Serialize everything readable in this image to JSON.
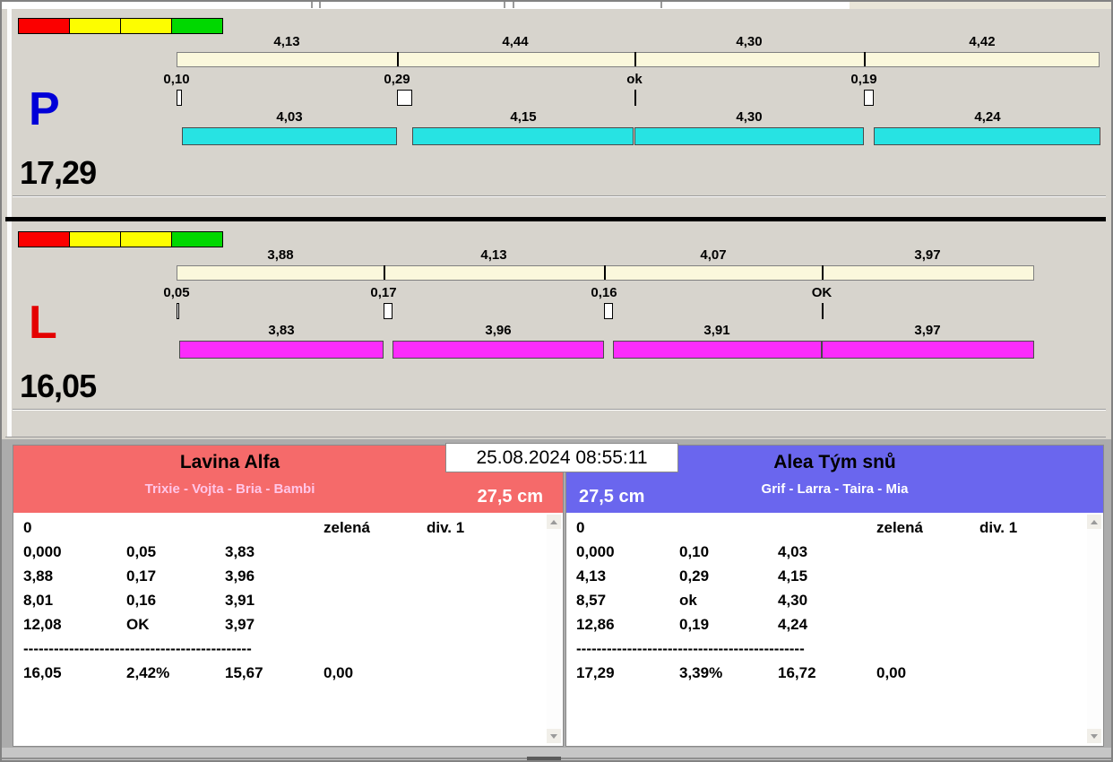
{
  "colors": {
    "cream_bar": "#fbf8dc",
    "light_red": "#fb0000",
    "light_yellow": "#fdfd00",
    "light_green": "#00d800"
  },
  "lanes": [
    {
      "letter": "P",
      "letter_color": "#0000d8",
      "total": "17,29",
      "bar_color": "#27e3e3",
      "lights": [
        "#fb0000",
        "#fdfd00",
        "#fdfd00",
        "#00d800"
      ],
      "top_values": [
        "4,13",
        "4,44",
        "4,30",
        "4,42"
      ],
      "delays": [
        "0,10",
        "0,29",
        "ok",
        "0,19"
      ],
      "bottom_values": [
        "4,03",
        "4,15",
        "4,30",
        "4,24"
      ]
    },
    {
      "letter": "L",
      "letter_color": "#e40000",
      "total": "16,05",
      "bar_color": "#fb2cfb",
      "lights": [
        "#fb0000",
        "#fdfd00",
        "#fdfd00",
        "#00d800"
      ],
      "top_values": [
        "3,88",
        "4,13",
        "4,07",
        "3,97"
      ],
      "delays": [
        "0,05",
        "0,17",
        "0,16",
        "OK"
      ],
      "bottom_values": [
        "3,83",
        "3,96",
        "3,91",
        "3,97"
      ]
    }
  ],
  "timestamp": "25.08.2024 08:55:11",
  "teams": [
    {
      "name": "Lavina Alfa",
      "members": "Trixie - Vojta - Bria - Bambi",
      "height": "27,5 cm",
      "header_color": "#f56a6a",
      "members_color": "#ffc6e8",
      "info": {
        "col1": "0",
        "col4": "zelená",
        "col5": "div. 1"
      },
      "rows": [
        [
          "0,000",
          "0,05",
          "3,83"
        ],
        [
          "3,88",
          "0,17",
          "3,96"
        ],
        [
          "8,01",
          "0,16",
          "3,91"
        ],
        [
          "12,08",
          "OK",
          "3,97"
        ]
      ],
      "divider": "---------------------------------------------",
      "totals": [
        "16,05",
        "2,42%",
        "15,67",
        "0,00"
      ]
    },
    {
      "name": "Alea Tým snů",
      "members": "Grif - Larra - Taira - Mia",
      "height": "27,5 cm",
      "header_color": "#6a66ee",
      "members_color": "#ffffff",
      "info": {
        "col1": "0",
        "col4": "zelená",
        "col5": "div. 1"
      },
      "rows": [
        [
          "0,000",
          "0,10",
          "4,03"
        ],
        [
          "4,13",
          "0,29",
          "4,15"
        ],
        [
          "8,57",
          "ok",
          "4,30"
        ],
        [
          "12,86",
          "0,19",
          "4,24"
        ]
      ],
      "divider": "---------------------------------------------",
      "totals": [
        "17,29",
        "3,39%",
        "16,72",
        "0,00"
      ]
    }
  ]
}
